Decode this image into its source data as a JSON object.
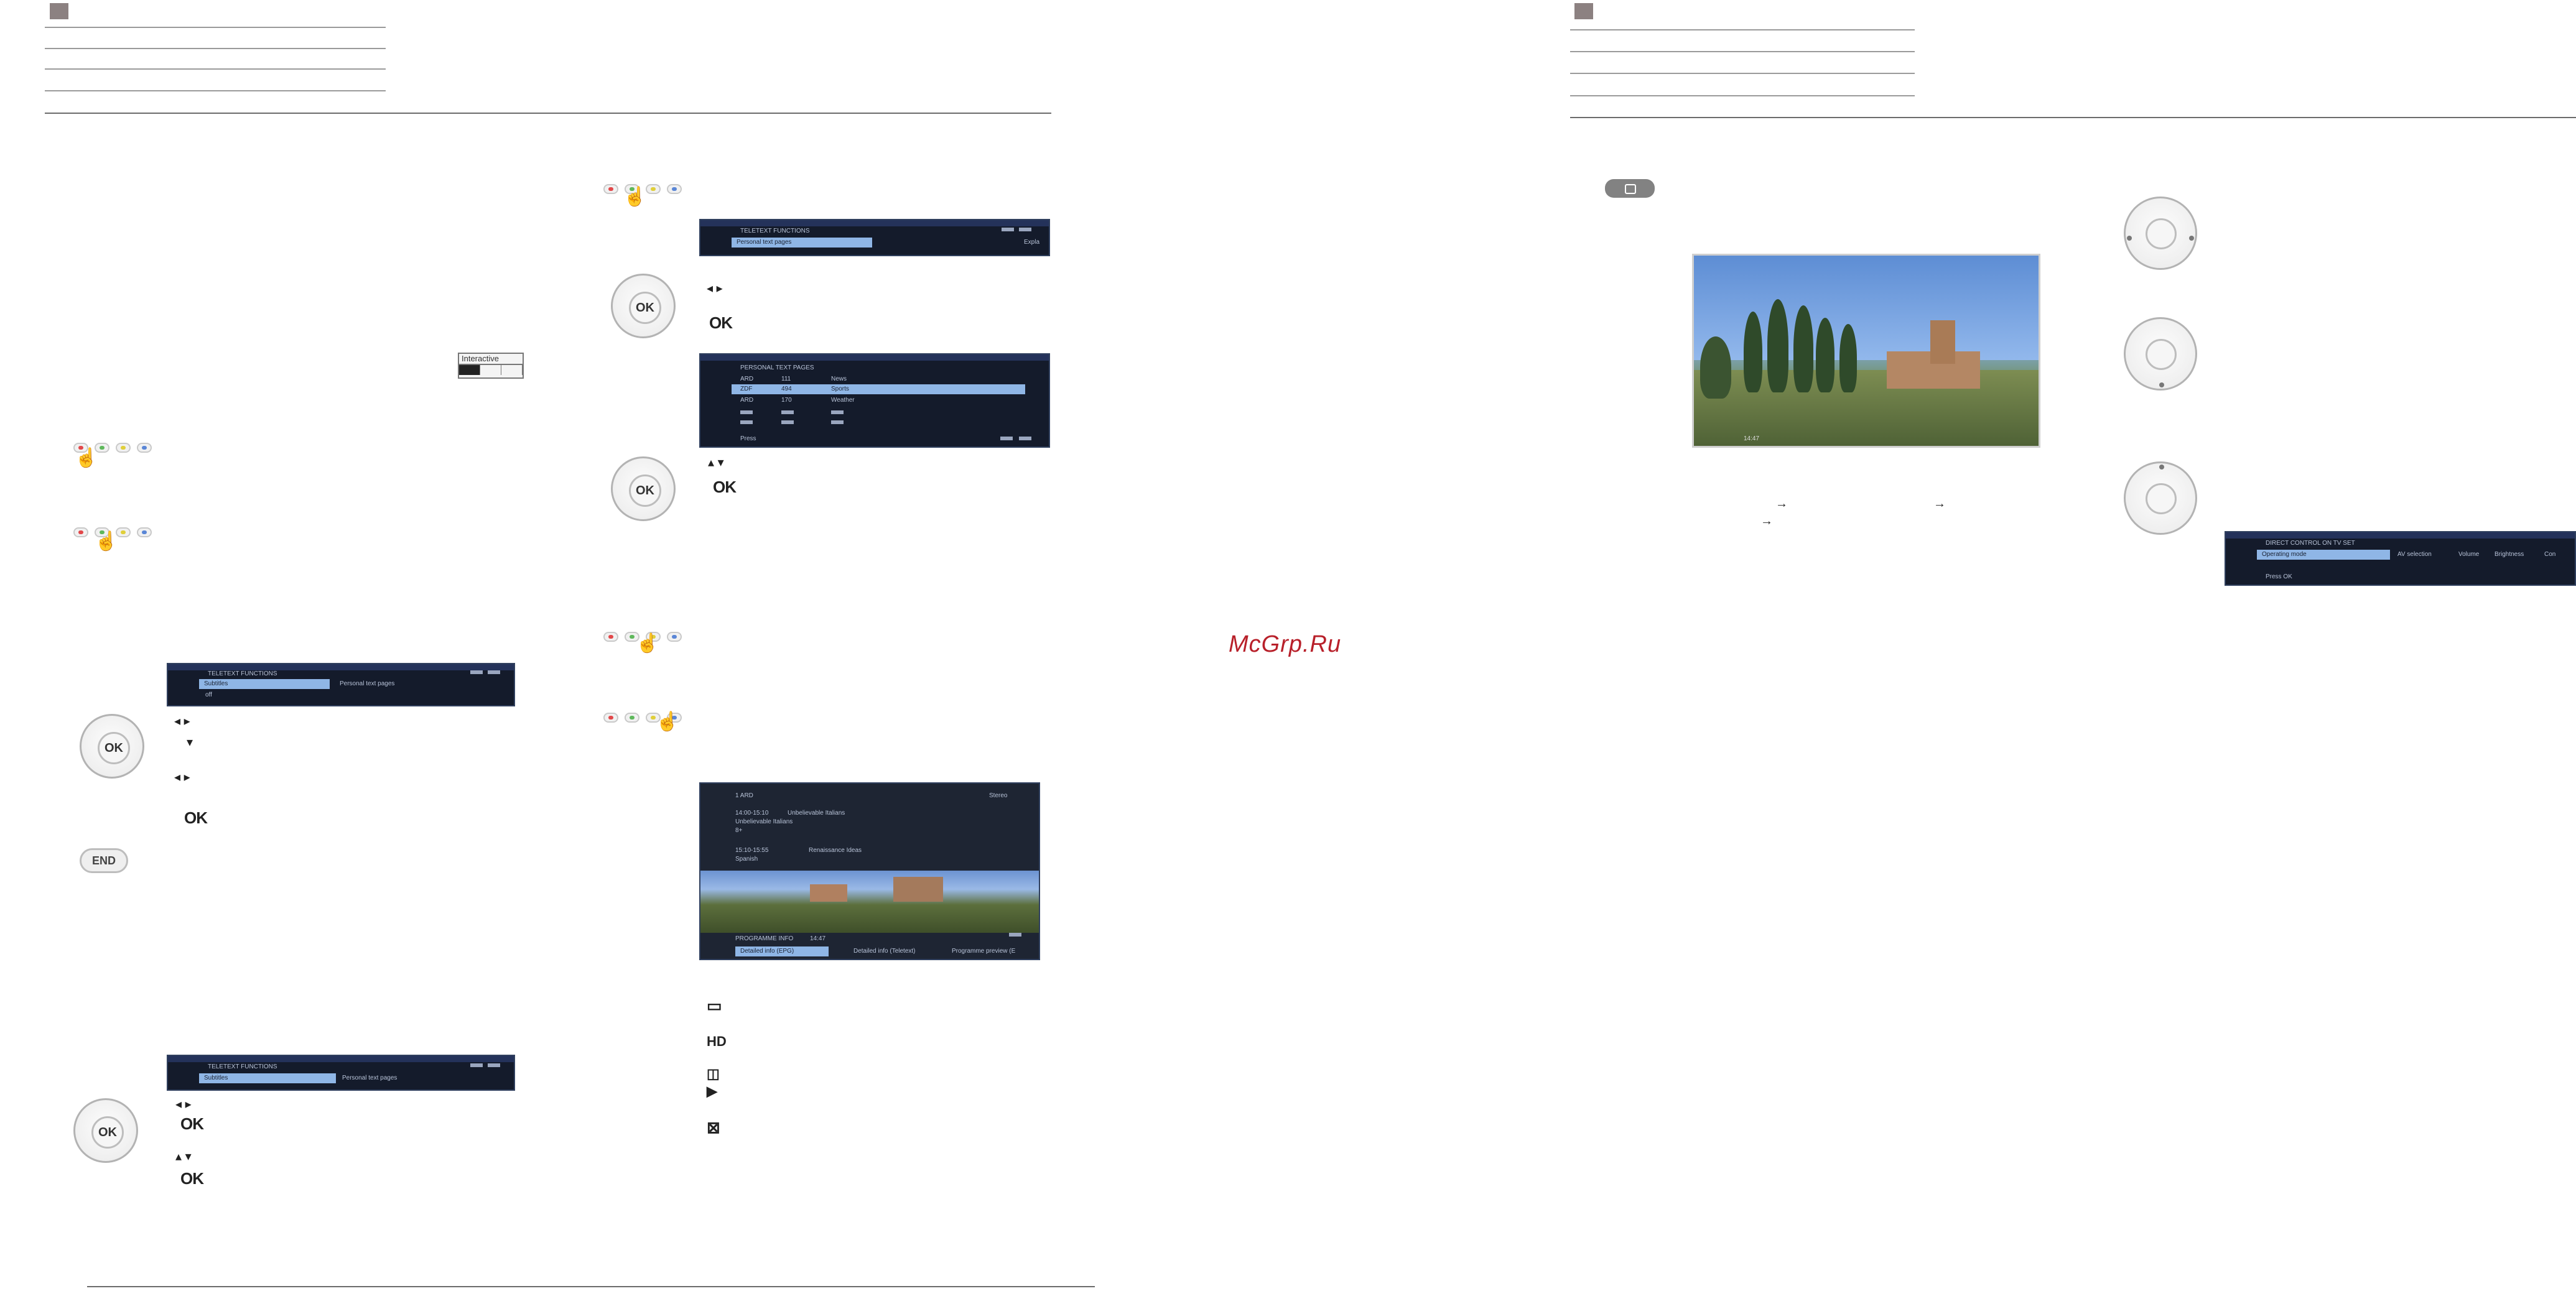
{
  "watermark": "McGrp.Ru",
  "interactive_box": {
    "label": "Interactive"
  },
  "ok_label": "OK",
  "end_label": "END",
  "arrow": "→",
  "arrows": {
    "left_right": "◂ ▸",
    "down": "▾",
    "up_down": "▴ ▾"
  },
  "menus": {
    "teletext_top": {
      "title": "TELETEXT FUNCTIONS",
      "item": "Personal text pages",
      "right": "Expla"
    },
    "personal_pages": {
      "title": "PERSONAL TEXT PAGES",
      "headers": [
        "ARD",
        "111",
        "News"
      ],
      "rows": [
        [
          "ZDF",
          "494",
          "Sports"
        ],
        [
          "ARD",
          "170",
          "Weather"
        ]
      ],
      "footer": "Press"
    },
    "teletext_subtitles": {
      "title": "TELETEXT FUNCTIONS",
      "item": "Subtitles",
      "value": "Personal text pages",
      "sub": "off"
    },
    "teletext_bottom": {
      "title": "TELETEXT FUNCTIONS",
      "item": "Subtitles",
      "value": "Personal text pages"
    },
    "programme_info": {
      "channel": "1 ARD",
      "right": "Stereo",
      "time1": "14:00-15:10",
      "prog1": "Unbelievable Italians",
      "sub1": "Unbelievable Italians",
      "code1": "8+",
      "time2": "15:10-15:55",
      "prog2": "Renaissance Ideas",
      "sub2": "Spanish",
      "footer_title": "PROGRAMME INFO",
      "footer_time": "14:47",
      "tabs": [
        "Detailed info (EPG)",
        "Detailed info (Teletext)",
        "Programme preview (E"
      ]
    },
    "direct_control": {
      "title": "DIRECT CONTROL ON TV SET",
      "item": "Operating mode",
      "options": [
        "AV selection",
        "Volume",
        "Brightness",
        "Con"
      ],
      "footer": "Press OK"
    }
  },
  "photo_caption": {
    "left": "",
    "time": "14:47"
  }
}
